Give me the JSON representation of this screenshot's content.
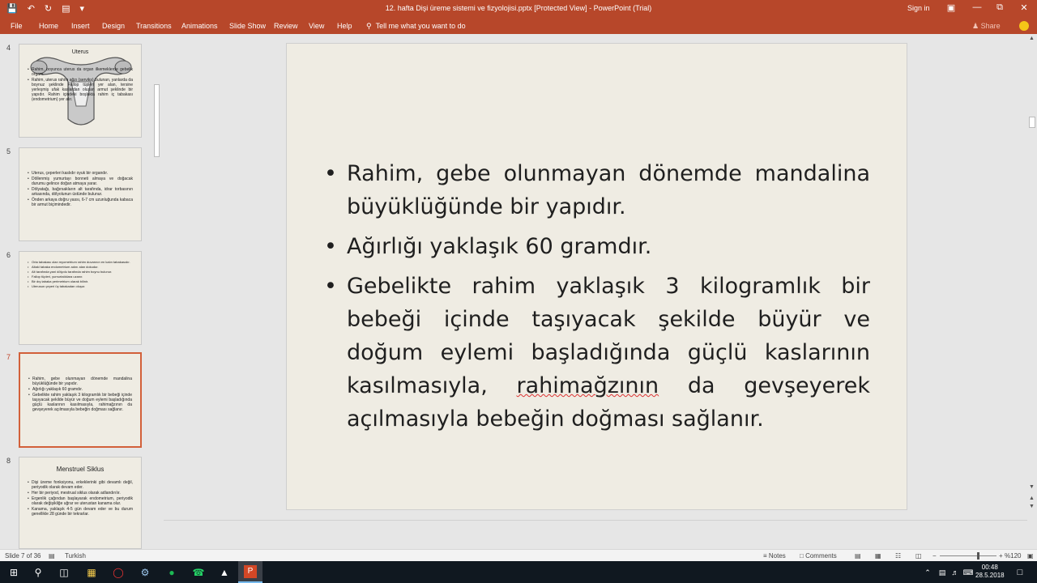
{
  "titlebar": {
    "doc_title": "12. hafta Dişi üreme sistemi ve fizyolojisi.pptx [Protected View] - PowerPoint (Trial)",
    "signin": "Sign in",
    "qat_icons": [
      "save-icon",
      "undo-icon",
      "redo-icon",
      "present-icon",
      "customize-icon"
    ]
  },
  "ribbon": {
    "tabs": [
      "File",
      "Home",
      "Insert",
      "Design",
      "Transitions",
      "Animations",
      "Slide Show",
      "Review",
      "View",
      "Help"
    ],
    "tell_me": "Tell me what you want to do",
    "share": "Share"
  },
  "thumbnails": [
    {
      "num": "4",
      "title": "Uterus",
      "bullets": [
        "Rahim, boyunca uterus da organ ilkemeklerde gebelik organı.",
        "Rahim, uterus rahim ağzı (serviks) bulunan, yanlarda da boynuz şeklinde Fallop tüpleri yer alan, tersine yerleşmiş ufak kaslardan oluşan armut şeklinde bir yapıdır. Rahim içindeki boşlukta rahim iç tabakası (endometrium) yer alır."
      ]
    },
    {
      "num": "5",
      "bullets": [
        "Uterus, çeperleri kaslıdır oyuk bir organdır.",
        "Döllenmiş yumurtayı bonneti almaya ve doğacak durumu gelince doğan atmaya yarar.",
        "Dölyatağı, bağırsakların alt tarafında, idrar torbasının arkasında, dölyolunun üstünde bulunur.",
        "Önden arkaya doğru yassı, 6-7 cm uzunluğunda kabaca bir armut biçimindedir."
      ]
    },
    {
      "num": "6",
      "bullets": [
        "Orta tabakası olan myometrium rahim duvarının en kalın tabakasıdır.",
        "Altaki tabaka endometrium adını alan dokudur.",
        "Alt tarafında yani dölyolu tarafında rahim boynu bulunur.",
        "Fallop tüpleri, yumurtalıklara uzanır.",
        "Bir dış tabaka perimetrium olarak bilinir.",
        "Uterusun çeperi üç tabakadan oluşur."
      ]
    },
    {
      "num": "7",
      "bullets": [
        "Rahim, gebe olunmayan dönemde mandalina büyüklüğünde bir yapıdır.",
        "Ağırlığı yaklaşık 60 gramdır.",
        "Gebelikte rahim yaklaşık 3 kilogramlık bir bebeği içinde taşıyacak şekilde büyür ve doğum eylemi başladığında güçlü kaslarının kasılmasıyla, rahimağzının da gevşeyerek açılmasıyla bebeğin doğması sağlanır."
      ]
    },
    {
      "num": "8",
      "title": "Menstruel Siklus",
      "bullets": [
        "Dişi üreme fonksiyonu, erkeklerinki gibi devamlı değil, periyodik olarak devam eder.",
        "Her bir periyod, mestrual siklus olarak adlandırılır.",
        "Ergenlik çağından başlayarak endometrium, periyodik olarak değişikliğe uğrar ve uterustan kanama olur.",
        "Kanama, yaklaşık 4-5 gün devam eder ve bu durum genellikle 28 günde bir tekrarlar."
      ]
    }
  ],
  "slide": {
    "bullets": [
      "Rahim, gebe olunmayan dönemde mandalina büyüklüğünde bir yapıdır.",
      "Ağırlığı yaklaşık 60 gramdır."
    ],
    "bullet3_before": "Gebelikte rahim yaklaşık 3 kilogramlık bir bebeği içinde taşıyacak şekilde büyür ve doğum eylemi başladığında güçlü kaslarının kasılmasıyla,",
    "bullet3_spell": "rahimağzının",
    "bullet3_after": "da gevşeyerek açılmasıyla bebeğin doğması sağlanır."
  },
  "status": {
    "slide_counter": "Slide 7 of 36",
    "language": "Turkish",
    "notes": "Notes",
    "comments": "Comments",
    "zoom": "%120",
    "zoom_level_percent": 120
  },
  "taskbar": {
    "time": "00:48",
    "date": "28.5.2018"
  },
  "colors": {
    "accent": "#b7472a",
    "slide_bg": "#efece3",
    "active_thumb_border": "#d2603a"
  }
}
